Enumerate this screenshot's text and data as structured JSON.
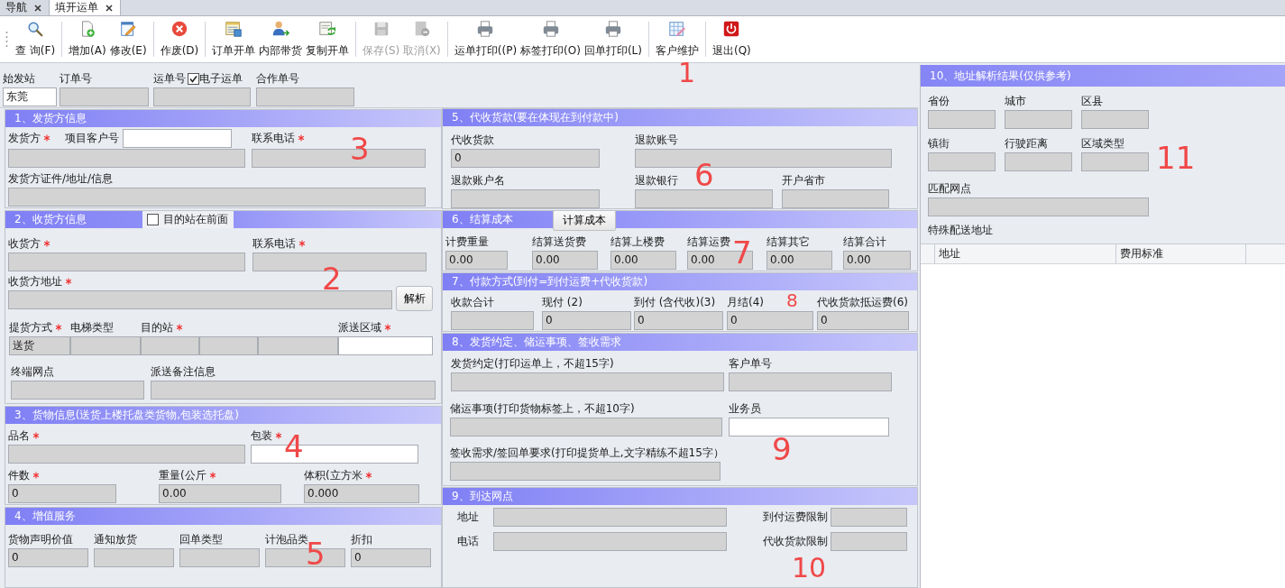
{
  "tabs": [
    {
      "label": "导航",
      "selected": false
    },
    {
      "label": "填开运单",
      "selected": true
    }
  ],
  "toolbar": [
    [
      {
        "kind": "search",
        "label": "查 询(F)",
        "disabled": false
      }
    ],
    [
      {
        "kind": "add",
        "label": "增加(A)",
        "disabled": false
      },
      {
        "kind": "edit",
        "label": "修改(E)",
        "disabled": false
      }
    ],
    [
      {
        "kind": "void",
        "label": "作废(D)",
        "disabled": false
      }
    ],
    [
      {
        "kind": "order",
        "label": "订单开单",
        "disabled": false
      },
      {
        "kind": "person",
        "label": "内部带货",
        "disabled": false
      },
      {
        "kind": "copy",
        "label": "复制开单",
        "disabled": false
      }
    ],
    [
      {
        "kind": "save",
        "label": "保存(S)",
        "disabled": true
      },
      {
        "kind": "cancel",
        "label": "取消(X)",
        "disabled": true
      }
    ],
    [
      {
        "kind": "print",
        "label": "运单打印((P)",
        "disabled": false
      },
      {
        "kind": "print",
        "label": "标签打印(O)",
        "disabled": false
      },
      {
        "kind": "print",
        "label": "回单打印(L)",
        "disabled": false
      }
    ],
    [
      {
        "kind": "customer",
        "label": "客户维护",
        "disabled": false
      }
    ],
    [
      {
        "kind": "exit",
        "label": "退出(Q)",
        "disabled": false
      }
    ]
  ],
  "header": {
    "fields": [
      {
        "label": "始发站",
        "value": "东莞",
        "readonly": false
      },
      {
        "label": "订单号",
        "readonly": true
      },
      {
        "label": "运单号",
        "readonly": true
      },
      {
        "label": "合作单号",
        "readonly": true
      }
    ],
    "e_waybill": {
      "label": "电子运单",
      "checked": true
    }
  },
  "left_sections": [
    {
      "title": "1、发货方信息",
      "fields": [
        {
          "label": "发货方",
          "required": true,
          "readonly": true
        },
        {
          "label": "项目客户号",
          "readonly": false
        },
        {
          "label": "联系电话",
          "required": true,
          "readonly": true
        },
        {
          "label": "发货方证件/地址/信息",
          "readonly": true
        }
      ]
    },
    {
      "title": "2、收货方信息",
      "option": {
        "label": "目的站在前面",
        "checked": false
      },
      "button": "解析",
      "fields": [
        {
          "label": "收货方",
          "required": true,
          "readonly": true
        },
        {
          "label": "联系电话",
          "required": true,
          "readonly": true
        },
        {
          "label": "收货方地址",
          "required": true,
          "readonly": true
        },
        {
          "label": "提货方式",
          "required": true,
          "value": "送货",
          "readonly": true
        },
        {
          "label": "电梯类型",
          "readonly": true
        },
        {
          "label": "目的站",
          "required": true,
          "readonly": true
        },
        {
          "readonly": true
        },
        {
          "readonly": true
        },
        {
          "label": "派送区域",
          "required": true,
          "readonly": false
        },
        {
          "label": "终端网点",
          "readonly": true
        },
        {
          "label": "派送备注信息",
          "readonly": true
        }
      ]
    },
    {
      "title": "3、货物信息(送货上楼托盘类货物,包装选托盘)",
      "fields": [
        {
          "label": "品名",
          "required": true,
          "readonly": true
        },
        {
          "label": "包装",
          "required": true,
          "readonly": false
        },
        {
          "label": "件数",
          "required": true,
          "value": "0",
          "readonly": true
        },
        {
          "label": "重量(公斤",
          "required": true,
          "value": "0.00",
          "readonly": true
        },
        {
          "label": "体积(立方米",
          "required": true,
          "value": "0.000",
          "readonly": true
        }
      ]
    },
    {
      "title": "4、增值服务",
      "fields": [
        {
          "label": "货物声明价值",
          "value": "0",
          "readonly": true
        },
        {
          "label": "通知放货",
          "readonly": true
        },
        {
          "label": "回单类型",
          "readonly": true
        },
        {
          "label": "计泡品类",
          "readonly": true
        },
        {
          "label": "折扣",
          "value": "0",
          "readonly": true
        }
      ]
    }
  ],
  "middle_sections": [
    {
      "title": "5、代收货款(要在体现在到付款中)",
      "fields": [
        {
          "label": "代收货款",
          "value": "0",
          "readonly": true
        },
        {
          "label": "退款账号",
          "readonly": true
        },
        {
          "label": "退款账户名",
          "readonly": true
        },
        {
          "label": "退款银行",
          "readonly": true
        },
        {
          "label": "开户省市",
          "readonly": true
        }
      ]
    },
    {
      "title": "6、结算成本",
      "button": "计算成本",
      "fields": [
        {
          "label": "计费重量",
          "value": "0.00",
          "readonly": true
        },
        {
          "label": "结算送货费",
          "value": "0.00",
          "readonly": true
        },
        {
          "label": "结算上楼费",
          "value": "0.00",
          "readonly": true
        },
        {
          "label": "结算运费",
          "value": "0.00",
          "readonly": true
        },
        {
          "label": "结算其它",
          "value": "0.00",
          "readonly": true
        },
        {
          "label": "结算合计",
          "value": "0.00",
          "readonly": true
        }
      ]
    },
    {
      "title": "7、付款方式(到付=到付运费+代收货款)",
      "fields": [
        {
          "label": "收款合计",
          "readonly": true
        },
        {
          "label": "现付 (2)",
          "value": "0",
          "readonly": true
        },
        {
          "label": "到付 (含代收)(3)",
          "value": "0",
          "readonly": true
        },
        {
          "label": "月结(4)",
          "value": "0",
          "readonly": true
        },
        {
          "label": "代收货款抵运费(6)",
          "value": "0",
          "readonly": true
        }
      ]
    },
    {
      "title": "8、发货约定、储运事项、签收需求",
      "fields": [
        {
          "label": "发货约定(打印运单上，不超15字)",
          "readonly": true
        },
        {
          "label": "客户单号",
          "readonly": true
        },
        {
          "label": "储运事项(打印货物标签上，不超10字)",
          "readonly": true
        },
        {
          "label": "业务员",
          "readonly": false
        },
        {
          "label": "签收需求/签回单要求(打印提货单上,文字精练不超15字）",
          "readonly": true
        }
      ]
    },
    {
      "title": "9、到达网点",
      "fields": [
        {
          "label": "地址",
          "readonly": true
        },
        {
          "label": "到付运费限制",
          "readonly": true
        },
        {
          "label": "电话",
          "readonly": true
        },
        {
          "label": "代收货款限制",
          "readonly": true
        }
      ]
    }
  ],
  "address_result": {
    "title": "10、地址解析结果(仅供参考)",
    "fields": [
      {
        "label": "省份",
        "readonly": true
      },
      {
        "label": "城市",
        "readonly": true
      },
      {
        "label": "区县",
        "readonly": true
      },
      {
        "label": "镇街",
        "readonly": true
      },
      {
        "label": "行驶距离",
        "readonly": true
      },
      {
        "label": "区域类型",
        "readonly": true
      },
      {
        "label": "匹配网点",
        "readonly": true
      }
    ],
    "special_label": "特殊配送地址",
    "table": {
      "columns": [
        "地址",
        "费用标准"
      ]
    }
  },
  "annotations": [
    "1",
    "2",
    "3",
    "4",
    "5",
    "6",
    "7",
    "8",
    "9",
    "10",
    "11"
  ]
}
